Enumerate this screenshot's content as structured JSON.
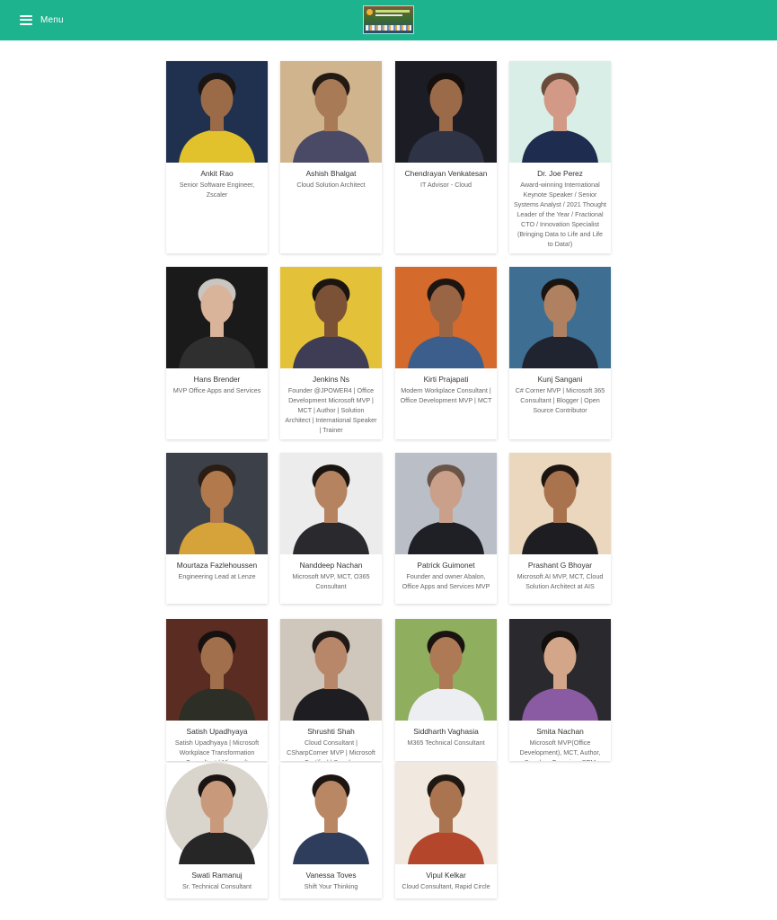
{
  "header": {
    "menu_label": "Menu",
    "logo_icon": "event-logo-icon",
    "accent_color": "#1eb38f"
  },
  "speakers": [
    {
      "name": "Ankit Rao",
      "title": "Senior Software Engineer, Zscaler",
      "bg": "#20304f",
      "skin": "#9b6b47",
      "hair": "#1a1412",
      "shirt": "#e2c22c"
    },
    {
      "name": "Ashish Bhalgat",
      "title": "Cloud Solution Architect",
      "bg": "#cfb48e",
      "skin": "#a87a55",
      "hair": "#241a14",
      "shirt": "#4b4a66"
    },
    {
      "name": "Chendrayan Venkatesan",
      "title": "IT Advisor - Cloud",
      "bg": "#1c1c24",
      "skin": "#9a6a49",
      "hair": "#15100d",
      "shirt": "#2e3346"
    },
    {
      "name": "Dr. Joe Perez",
      "title": "Award-winning International Keynote Speaker / Senior Systems Analyst / 2021 Thought Leader of the Year / Fractional CTO / Innovation Specialist (Bringing Data to Life and Life to Data!)",
      "bg": "#d8eee6",
      "skin": "#d29a86",
      "hair": "#6a4a39",
      "shirt": "#1e2d4f"
    },
    {
      "name": "Hans Brender",
      "title": "MVP Office Apps and Services",
      "bg": "#1a1a1a",
      "skin": "#d9b39a",
      "hair": "#c9c5c0",
      "shirt": "#2f2f2f"
    },
    {
      "name": "Jenkins Ns",
      "title": "Founder @JPOWER4 | Office Development Microsoft MVP | MCT | Author | Solution Architect | International Speaker | Trainer",
      "bg": "#e3c23a",
      "skin": "#7c5236",
      "hair": "#1b1410",
      "shirt": "#3f3c55"
    },
    {
      "name": "Kirti Prajapati",
      "title": "Modern Workplace Consultant | Office Development MVP | MCT",
      "bg": "#d46a2b",
      "skin": "#9a6545",
      "hair": "#1c1511",
      "shirt": "#3b5e8c"
    },
    {
      "name": "Kunj Sangani",
      "title": "C# Corner MVP | Microsoft 365 Consultant | Blogger | Open Source Contributor",
      "bg": "#3f6e93",
      "skin": "#b08160",
      "hair": "#1a1411",
      "shirt": "#1f2430"
    },
    {
      "name": "Mourtaza Fazlehoussen",
      "title": "Engineering Lead at Lenze",
      "bg": "#3c4049",
      "skin": "#b27a4c",
      "hair": "#2b1d14",
      "shirt": "#d6a23a"
    },
    {
      "name": "Nanddeep Nachan",
      "title": "Microsoft MVP, MCT, O365 Consultant",
      "bg": "#ececec",
      "skin": "#b58360",
      "hair": "#1a1411",
      "shirt": "#2a2a2e"
    },
    {
      "name": "Patrick Guimonet",
      "title": "Founder and owner Abalon, Office Apps and Services MVP",
      "bg": "#b9bec7",
      "skin": "#caa08a",
      "hair": "#6a5548",
      "shirt": "#1f1f26"
    },
    {
      "name": "Prashant G Bhoyar",
      "title": "Microsoft AI MVP, MCT, Cloud Solution Architect at AIS",
      "bg": "#ead7bd",
      "skin": "#a9734e",
      "hair": "#1c1410",
      "shirt": "#1e1e22"
    },
    {
      "name": "Satish Upadhyaya",
      "title": "Satish Upadhyaya | Microsoft Workplace Transformation Consultant | Microsoft Community Speaker",
      "bg": "#5a2c22",
      "skin": "#a26f4c",
      "hair": "#16110e",
      "shirt": "#2d2e25"
    },
    {
      "name": "Shrushti Shah",
      "title": "Cloud Consultant | CSharpCorner MVP | Microsoft Certified | Speaker",
      "bg": "#cfc7bb",
      "skin": "#b8876a",
      "hair": "#211915",
      "shirt": "#1e1e22"
    },
    {
      "name": "Siddharth Vaghasia",
      "title": "M365 Technical Consultant",
      "bg": "#8fae5e",
      "skin": "#ad7a55",
      "hair": "#1a1411",
      "shirt": "#eceef2"
    },
    {
      "name": "Smita Nachan",
      "title": "Microsoft MVP(Office Development), MCT, Author, Speaker, Organizer SEM",
      "bg": "#2a2a2e",
      "skin": "#d3a689",
      "hair": "#120e0c",
      "shirt": "#8a5aa3"
    },
    {
      "name": "Swati Ramanuj",
      "title": "Sr. Technical Consultant",
      "bg": "#0e0e0e",
      "skin": "#c89a7b",
      "hair": "#1a1311",
      "shirt": "#262626",
      "round": true
    },
    {
      "name": "Vanessa Toves",
      "title": "Shift Your Thinking",
      "bg": "#ffffff",
      "skin": "#b98764",
      "hair": "#1c1512",
      "shirt": "#2f3d5c"
    },
    {
      "name": "Vipul Kelkar",
      "title": "Cloud Consultant, Rapid Circle",
      "bg": "#f1e9df",
      "skin": "#a9744f",
      "hair": "#1f1712",
      "shirt": "#b4462c"
    }
  ]
}
